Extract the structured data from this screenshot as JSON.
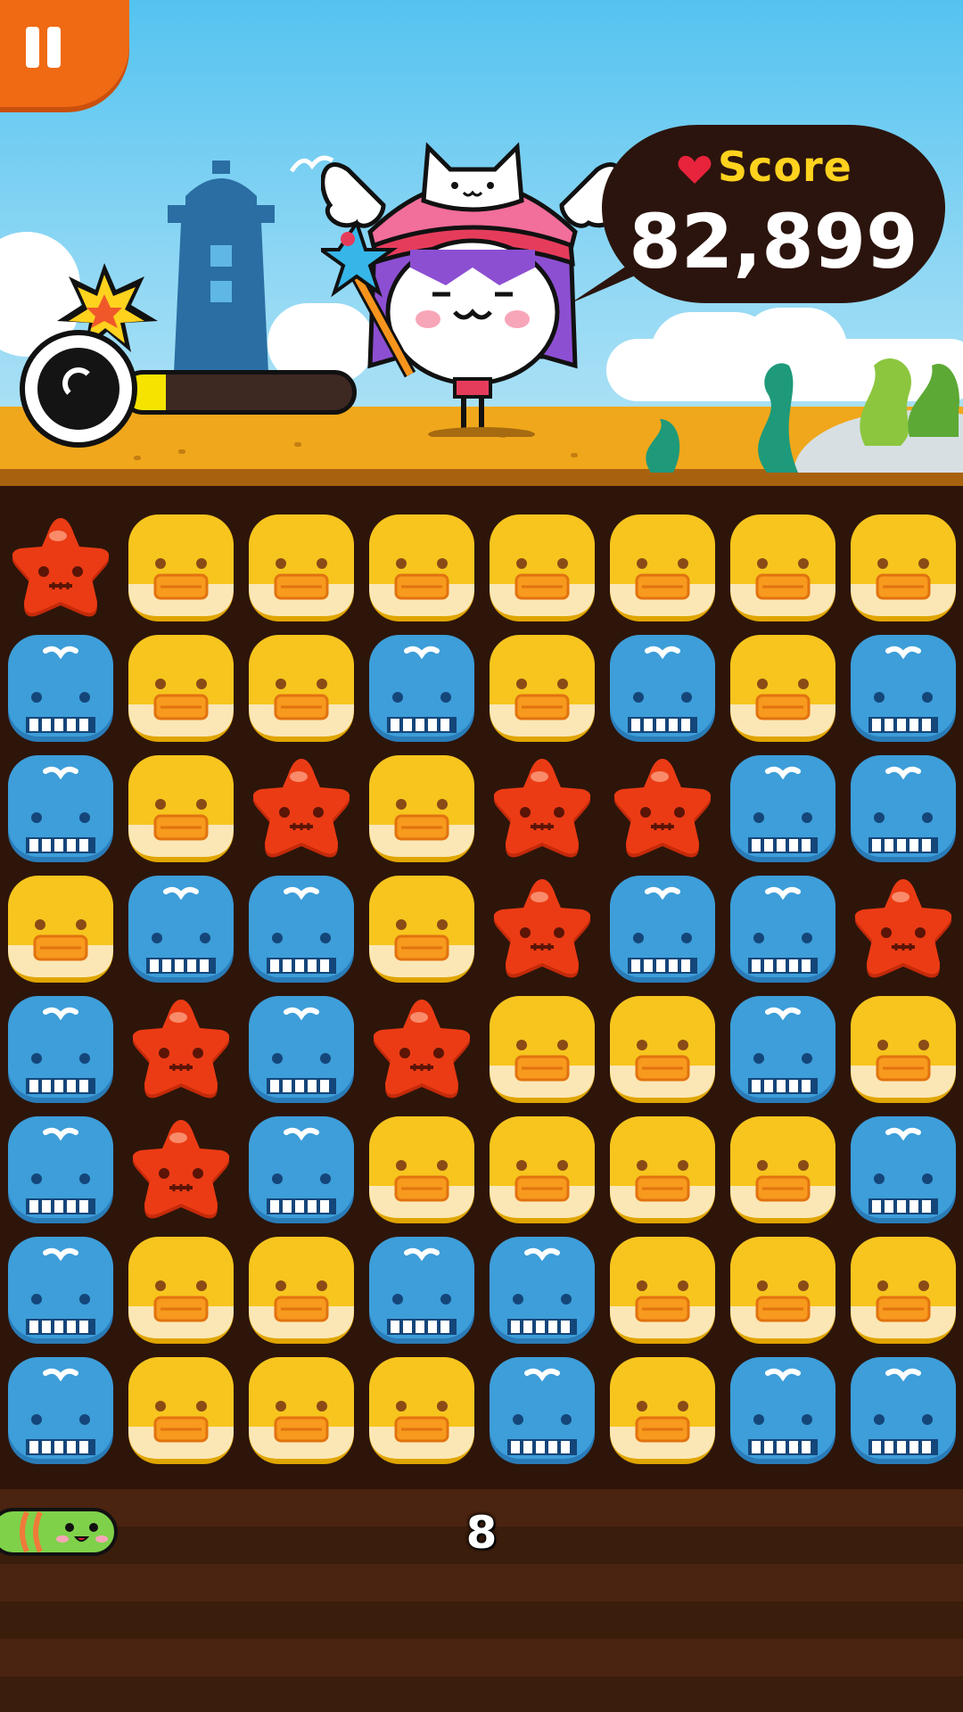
{
  "score": {
    "label": "Score",
    "value": "82,899"
  },
  "bomb_gauge": {
    "fill_fraction": 0.18
  },
  "moves": {
    "value": "8"
  },
  "colors": {
    "duck": "#f7c51e",
    "whale": "#3d9ed9",
    "star": "#eb3b14",
    "gauge": "#f6e400",
    "pause": "#f06a14"
  },
  "board": {
    "columns": 8,
    "rows": [
      [
        "star",
        "duck",
        "duck",
        "duck",
        "duck",
        "duck",
        "duck",
        "duck"
      ],
      [
        "whale",
        "duck",
        "duck",
        "whale",
        "duck",
        "whale",
        "duck",
        "whale"
      ],
      [
        "whale",
        "duck",
        "star",
        "duck",
        "star",
        "star",
        "whale",
        "whale"
      ],
      [
        "duck",
        "whale",
        "whale",
        "duck",
        "star",
        "whale",
        "whale",
        "star"
      ],
      [
        "whale",
        "star",
        "whale",
        "star",
        "duck",
        "duck",
        "whale",
        "duck"
      ],
      [
        "whale",
        "star",
        "whale",
        "duck",
        "duck",
        "duck",
        "duck",
        "whale"
      ],
      [
        "whale",
        "duck",
        "duck",
        "whale",
        "whale",
        "duck",
        "duck",
        "duck"
      ],
      [
        "whale",
        "duck",
        "duck",
        "duck",
        "whale",
        "duck",
        "whale",
        "whale"
      ]
    ]
  },
  "icons": {
    "pause": "pause-icon",
    "bomb": "bomb-icon",
    "heart": "heart-icon",
    "worm": "worm-icon"
  }
}
